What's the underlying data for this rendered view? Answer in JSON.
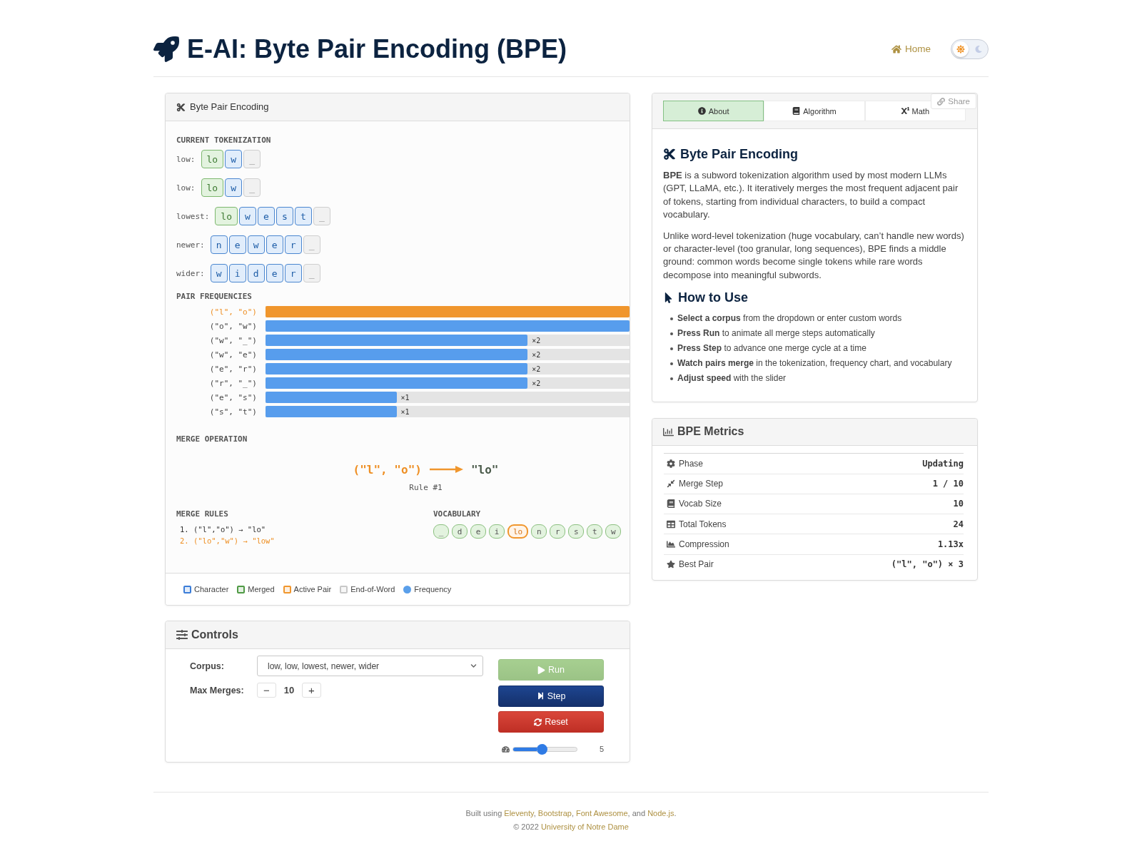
{
  "header": {
    "title": "E-AI: Byte Pair Encoding (BPE)",
    "home_link": "Home",
    "theme_toggle": {
      "dark": false
    }
  },
  "visualizer": {
    "title": "Byte Pair Encoding",
    "tokenization": {
      "heading": "CURRENT TOKENIZATION",
      "words": [
        {
          "label": "low:",
          "tokens": [
            {
              "text": "lo",
              "kind": "merged"
            },
            {
              "text": "w",
              "kind": "char"
            },
            {
              "text": "_",
              "kind": "eow"
            }
          ]
        },
        {
          "label": "low:",
          "tokens": [
            {
              "text": "lo",
              "kind": "merged"
            },
            {
              "text": "w",
              "kind": "char"
            },
            {
              "text": "_",
              "kind": "eow"
            }
          ]
        },
        {
          "label": "lowest:",
          "tokens": [
            {
              "text": "lo",
              "kind": "merged"
            },
            {
              "text": "w",
              "kind": "char"
            },
            {
              "text": "e",
              "kind": "char"
            },
            {
              "text": "s",
              "kind": "char"
            },
            {
              "text": "t",
              "kind": "char"
            },
            {
              "text": "_",
              "kind": "eow"
            }
          ]
        },
        {
          "label": "newer:",
          "tokens": [
            {
              "text": "n",
              "kind": "char"
            },
            {
              "text": "e",
              "kind": "char"
            },
            {
              "text": "w",
              "kind": "char"
            },
            {
              "text": "e",
              "kind": "char"
            },
            {
              "text": "r",
              "kind": "char"
            },
            {
              "text": "_",
              "kind": "eow"
            }
          ]
        },
        {
          "label": "wider:",
          "tokens": [
            {
              "text": "w",
              "kind": "char"
            },
            {
              "text": "i",
              "kind": "char"
            },
            {
              "text": "d",
              "kind": "char"
            },
            {
              "text": "e",
              "kind": "char"
            },
            {
              "text": "r",
              "kind": "char"
            },
            {
              "text": "_",
              "kind": "eow"
            }
          ]
        }
      ]
    },
    "pair_frequencies": {
      "heading": "PAIR FREQUENCIES",
      "pairs": [
        {
          "pair": "(\"l\", \"o\")",
          "level": 1,
          "active": true
        },
        {
          "pair": "(\"o\", \"w\")",
          "level": 1,
          "active": false
        },
        {
          "pair": "(\"w\", \"_\")",
          "level": 0.72,
          "count": "×2",
          "active": false
        },
        {
          "pair": "(\"w\", \"e\")",
          "level": 0.72,
          "count": "×2",
          "active": false
        },
        {
          "pair": "(\"e\", \"r\")",
          "level": 0.72,
          "count": "×2",
          "active": false
        },
        {
          "pair": "(\"r\", \"_\")",
          "level": 0.72,
          "count": "×2",
          "active": false
        },
        {
          "pair": "(\"e\", \"s\")",
          "level": 0.36,
          "count": "×1",
          "active": false
        },
        {
          "pair": "(\"s\", \"t\")",
          "level": 0.36,
          "count": "×1",
          "active": false
        }
      ]
    },
    "merge_operation": {
      "heading": "MERGE OPERATION",
      "pair": "(\"l\", \"o\")",
      "result": "\"lo\"",
      "rule": "Rule #1"
    },
    "merge_rules": {
      "heading": "MERGE RULES",
      "rules": [
        {
          "text": "1. (\"l\",\"o\") → \"lo\"",
          "active": false
        },
        {
          "text": "2. (\"lo\",\"w\") → \"low\"",
          "active": true
        }
      ]
    },
    "vocabulary": {
      "heading": "VOCABULARY",
      "tokens": [
        {
          "text": "_",
          "active": false
        },
        {
          "text": "d",
          "active": false
        },
        {
          "text": "e",
          "active": false
        },
        {
          "text": "i",
          "active": false
        },
        {
          "text": "lo",
          "active": true
        },
        {
          "text": "n",
          "active": false
        },
        {
          "text": "r",
          "active": false
        },
        {
          "text": "s",
          "active": false
        },
        {
          "text": "t",
          "active": false
        },
        {
          "text": "w",
          "active": false
        }
      ]
    },
    "legend": [
      {
        "label": "Character",
        "kind": "square",
        "color": "#3b7dd8"
      },
      {
        "label": "Merged",
        "kind": "square",
        "color": "#4f9a45"
      },
      {
        "label": "Active Pair",
        "kind": "square",
        "color": "#f0962d"
      },
      {
        "label": "End-of-Word",
        "kind": "square",
        "color": "#c8c8c8"
      },
      {
        "label": "Frequency",
        "kind": "dot",
        "color": "#5a9fea"
      }
    ]
  },
  "controls": {
    "title": "Controls",
    "corpus": {
      "label": "Corpus:",
      "value": "low, low, lowest, newer, wider"
    },
    "max_merges": {
      "label": "Max Merges:",
      "decrement": "−",
      "value": "10",
      "increment": "+"
    },
    "buttons": [
      {
        "label": "Run",
        "kind": "run",
        "disabled": true
      },
      {
        "label": "Step",
        "kind": "step",
        "disabled": false
      },
      {
        "label": "Reset",
        "kind": "reset",
        "disabled": false
      }
    ],
    "speed": {
      "level": 0.45,
      "reading": "5"
    }
  },
  "info_panel": {
    "tabs": [
      {
        "label": "About",
        "selected": true
      },
      {
        "label": "Algorithm",
        "selected": false
      },
      {
        "label": "Math",
        "selected": false
      }
    ],
    "share": "Share",
    "heading": "Byte Pair Encoding",
    "paragraphs": [
      "**BPE** is a subword tokenization algorithm used by most modern LLMs (GPT, LLaMA, etc.). It iteratively merges the most frequent adjacent pair of tokens, starting from individual characters, to build a compact vocabulary.",
      "Unlike word-level tokenization (huge vocabulary, can’t handle new words) or character-level (too granular, long sequences), BPE finds a middle ground: common words become single tokens while rare words decompose into meaningful subwords."
    ],
    "how_to_heading": "How to Use",
    "steps": [
      "**Select a corpus** from the dropdown or enter custom words",
      "**Press Run** to animate all merge steps automatically",
      "**Press Step** to advance one merge cycle at a time",
      "**Watch pairs merge** in the tokenization, frequency chart, and vocabulary",
      "**Adjust speed** with the slider"
    ]
  },
  "metrics": {
    "title": "BPE Metrics",
    "rows": [
      {
        "label": "Phase",
        "value": "Updating"
      },
      {
        "label": "Merge Step",
        "value": "1 / 10"
      },
      {
        "label": "Vocab Size",
        "value": "10"
      },
      {
        "label": "Total Tokens",
        "value": "24"
      },
      {
        "label": "Compression",
        "value": "1.13x"
      },
      {
        "label": "Best Pair",
        "value": "(\"l\", \"o\") × 3"
      }
    ]
  },
  "footer": {
    "credits": [
      {
        "text": "Built using ",
        "kind": "text"
      },
      {
        "text": "Eleventy",
        "kind": "link"
      },
      {
        "text": ", ",
        "kind": "text"
      },
      {
        "text": "Bootstrap",
        "kind": "link"
      },
      {
        "text": ", ",
        "kind": "text"
      },
      {
        "text": "Font Awesome",
        "kind": "link"
      },
      {
        "text": ", and ",
        "kind": "text"
      },
      {
        "text": "Node.js",
        "kind": "link"
      },
      {
        "text": ".",
        "kind": "text"
      }
    ],
    "copyright": [
      {
        "text": "© 2022 ",
        "kind": "text"
      },
      {
        "text": "University of Notre Dame",
        "kind": "link"
      }
    ]
  }
}
